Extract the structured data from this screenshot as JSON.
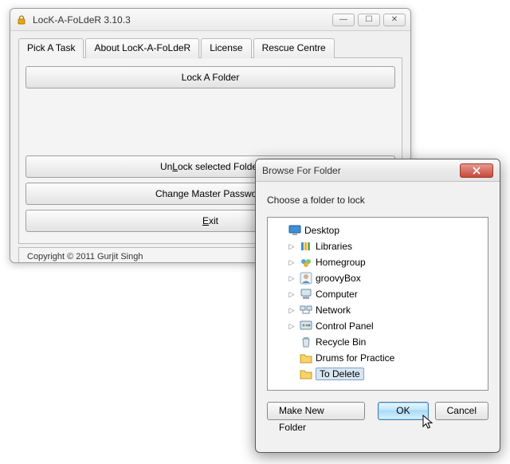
{
  "main": {
    "title": "LocK-A-FoLdeR 3.10.3",
    "tabs": [
      {
        "label": "Pick A Task",
        "active": true
      },
      {
        "label": "About LocK-A-FoLdeR",
        "active": false
      },
      {
        "label": "License",
        "active": false
      },
      {
        "label": "Rescue Centre",
        "active": false
      }
    ],
    "lock_btn": "Lock A Folder",
    "unlock_btn_pre": "Un",
    "unlock_btn_u": "L",
    "unlock_btn_post": "ock selected Folder",
    "change_pw_btn": "Change Master Password",
    "exit_btn_u": "E",
    "exit_btn_post": "xit",
    "copyright": "Copyright © 2011 Gurjit Singh"
  },
  "dialog": {
    "title": "Browse For Folder",
    "instruction": "Choose a folder to lock",
    "items": [
      {
        "label": "Desktop",
        "expandable": false,
        "icon": "desktop",
        "indent": 0,
        "selected": false
      },
      {
        "label": "Libraries",
        "expandable": true,
        "icon": "libraries",
        "indent": 1,
        "selected": false
      },
      {
        "label": "Homegroup",
        "expandable": true,
        "icon": "homegroup",
        "indent": 1,
        "selected": false
      },
      {
        "label": "groovyBox",
        "expandable": true,
        "icon": "user",
        "indent": 1,
        "selected": false
      },
      {
        "label": "Computer",
        "expandable": true,
        "icon": "computer",
        "indent": 1,
        "selected": false
      },
      {
        "label": "Network",
        "expandable": true,
        "icon": "network",
        "indent": 1,
        "selected": false
      },
      {
        "label": "Control Panel",
        "expandable": true,
        "icon": "control",
        "indent": 1,
        "selected": false
      },
      {
        "label": "Recycle Bin",
        "expandable": false,
        "icon": "recycle",
        "indent": 1,
        "selected": false
      },
      {
        "label": "Drums for Practice",
        "expandable": false,
        "icon": "folder",
        "indent": 1,
        "selected": false
      },
      {
        "label": "To Delete",
        "expandable": false,
        "icon": "folder",
        "indent": 1,
        "selected": true
      }
    ],
    "make_new_btn": "Make New Folder",
    "ok_btn": "OK",
    "cancel_btn": "Cancel"
  }
}
